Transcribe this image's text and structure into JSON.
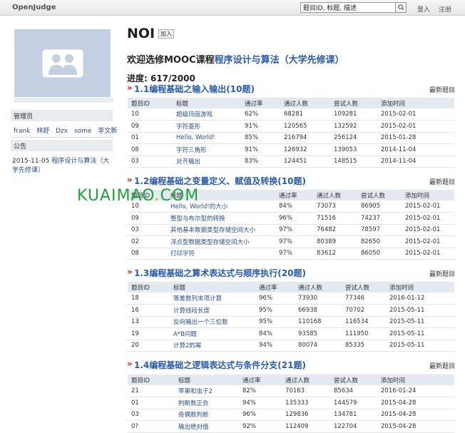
{
  "header": {
    "brand": "OpenJudge",
    "search_value": "题目ID, 标题, 描述",
    "login": "登入",
    "register": "注册"
  },
  "sidebar": {
    "admins_label": "管理员",
    "admins": [
      "frank",
      "林舒",
      "Dzx",
      "some",
      "李文新"
    ],
    "notice_label": "公告",
    "notice_date": "2015-11-05",
    "notice_text": "程序设计与算法（大学先修课）"
  },
  "group": {
    "title": "NOI",
    "join_label": "加入",
    "welcome_prefix": "欢迎选修MOOC课程",
    "course_name": "程序设计与算法（大学先修课）",
    "progress": "进度: 617/2000"
  },
  "columns": [
    "题目ID",
    "标题",
    "通过率",
    "通过人数",
    "尝试人数",
    "添加时间"
  ],
  "latest_label": "最新题目",
  "sections": [
    {
      "title": "1.1编程基础之输入输出(10题)",
      "rows": [
        [
          "10",
          "超级玛丽游戏",
          "62%",
          "68281",
          "109281",
          "2015-02-01"
        ],
        [
          "09",
          "字符菱形",
          "91%",
          "120565",
          "132592",
          "2015-02-01"
        ],
        [
          "01",
          "Hello, World!",
          "85%",
          "216794",
          "256124",
          "2015-01-28"
        ],
        [
          "08",
          "字符三角形",
          "91%",
          "126932",
          "139053",
          "2014-11-04"
        ],
        [
          "03",
          "对齐输出",
          "83%",
          "124451",
          "148515",
          "2014-11-04"
        ]
      ]
    },
    {
      "title": "1.2编程基础之变量定义、赋值及转换(10题)",
      "rows": [
        [
          "10",
          "Hello, World!的大小",
          "84%",
          "73073",
          "86905",
          "2015-02-01"
        ],
        [
          "09",
          "整型与布尔型的转换",
          "96%",
          "71516",
          "74237",
          "2015-02-01"
        ],
        [
          "03",
          "其他基本数据类型存储空间大小",
          "97%",
          "76482",
          "78597",
          "2015-02-01"
        ],
        [
          "02",
          "浮点型数据类型存储空间大小",
          "97%",
          "80389",
          "82650",
          "2015-02-01"
        ],
        [
          "08",
          "打印字符",
          "97%",
          "83612",
          "86050",
          "2015-02-01"
        ]
      ]
    },
    {
      "title": "1.3编程基础之算术表达式与顺序执行(20题)",
      "rows": [
        [
          "18",
          "等差数列末项计算",
          "96%",
          "73930",
          "77346",
          "2016-01-12"
        ],
        [
          "16",
          "计算线段长度",
          "95%",
          "66938",
          "70702",
          "2015-05-11"
        ],
        [
          "13",
          "反向输出一个三位数",
          "95%",
          "110168",
          "116534",
          "2015-05-11"
        ],
        [
          "19",
          "A*B问题",
          "84%",
          "93585",
          "111950",
          "2015-05-11"
        ],
        [
          "20",
          "计算2的幂",
          "94%",
          "80074",
          "85335",
          "2015-05-11"
        ]
      ]
    },
    {
      "title": "1.4编程基础之逻辑表达式与条件分支(21题)",
      "rows": [
        [
          "21",
          "苹果和虫子2",
          "82%",
          "70163",
          "85634",
          "2016-01-24"
        ],
        [
          "01",
          "判断数正负",
          "94%",
          "135333",
          "144579",
          "2015-04-28"
        ],
        [
          "03",
          "奇偶数判断",
          "96%",
          "129836",
          "134781",
          "2015-04-28"
        ],
        [
          "0?",
          "输出绝对值",
          "92%",
          "112409",
          "122704",
          "2015-04-28"
        ]
      ]
    }
  ],
  "watermark": {
    "part1": "KUAIMAO",
    "dot": ".",
    "part2": "COM"
  }
}
